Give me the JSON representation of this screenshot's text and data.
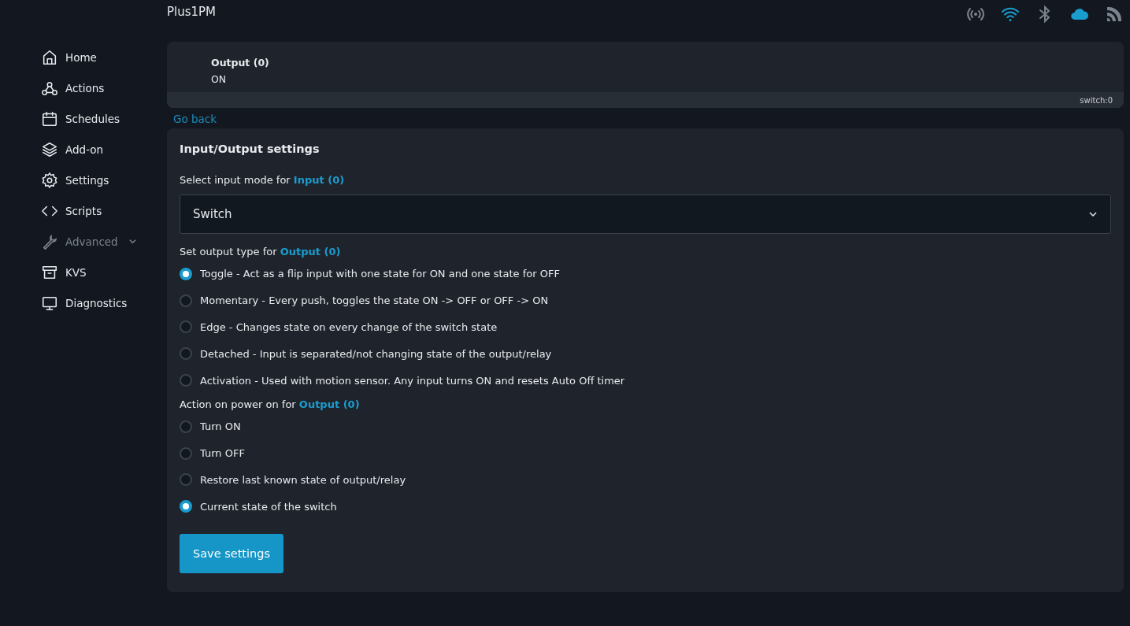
{
  "header": {
    "title": "Plus1PM",
    "status_icons": [
      {
        "kind": "signal",
        "active": false
      },
      {
        "kind": "wifi",
        "active": true
      },
      {
        "kind": "bluetooth",
        "active": false
      },
      {
        "kind": "cloud",
        "active": true
      },
      {
        "kind": "rss",
        "active": false
      }
    ]
  },
  "sidebar": {
    "items": [
      {
        "kind": "home",
        "label": "Home",
        "disabled": false,
        "expandable": false
      },
      {
        "kind": "actions",
        "label": "Actions",
        "disabled": false,
        "expandable": false
      },
      {
        "kind": "schedules",
        "label": "Schedules",
        "disabled": false,
        "expandable": false
      },
      {
        "kind": "addon",
        "label": "Add-on",
        "disabled": false,
        "expandable": false
      },
      {
        "kind": "settings",
        "label": "Settings",
        "disabled": false,
        "expandable": false
      },
      {
        "kind": "scripts",
        "label": "Scripts",
        "disabled": false,
        "expandable": false
      },
      {
        "kind": "advanced",
        "label": "Advanced",
        "disabled": true,
        "expandable": true
      },
      {
        "kind": "kvs",
        "label": "KVS",
        "disabled": false,
        "expandable": false
      },
      {
        "kind": "diagnostics",
        "label": "Diagnostics",
        "disabled": false,
        "expandable": false
      }
    ]
  },
  "output_card": {
    "name": "Output (0)",
    "state": "ON",
    "footer": "switch:0"
  },
  "go_back": "Go back",
  "settings": {
    "title": "Input/Output settings",
    "input_mode": {
      "label": "Select input mode for",
      "link": "Input (0)",
      "value": "Switch"
    },
    "output_type": {
      "label": "Set output type for",
      "link": "Output (0)",
      "options": [
        {
          "label": "Toggle - Act as a flip input with one state for ON and one state for OFF",
          "selected": true
        },
        {
          "label": "Momentary - Every push, toggles the state ON -> OFF or OFF -> ON",
          "selected": false
        },
        {
          "label": "Edge - Changes state on every change of the switch state",
          "selected": false
        },
        {
          "label": "Detached - Input is separated/not changing state of the output/relay",
          "selected": false
        },
        {
          "label": "Activation - Used with motion sensor. Any input turns ON and resets Auto Off timer",
          "selected": false
        }
      ]
    },
    "power_on": {
      "label": "Action on power on for",
      "link": "Output (0)",
      "options": [
        {
          "label": "Turn ON",
          "selected": false
        },
        {
          "label": "Turn OFF",
          "selected": false
        },
        {
          "label": "Restore last known state of output/relay",
          "selected": false
        },
        {
          "label": "Current state of the switch",
          "selected": true
        }
      ]
    },
    "save_button": "Save settings"
  }
}
